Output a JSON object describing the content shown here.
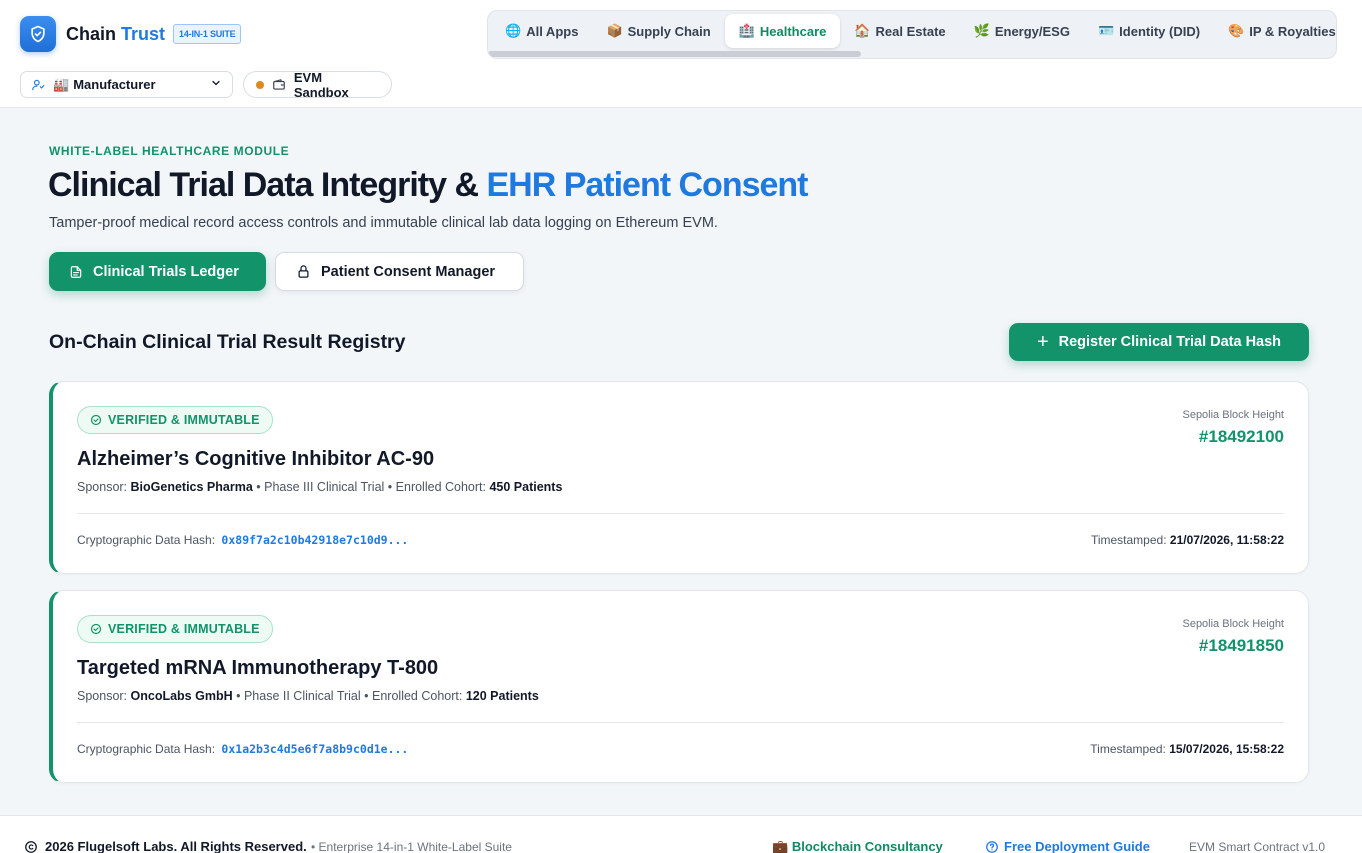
{
  "brand": {
    "name": "Chain",
    "accent": "Trust",
    "badge": "14-IN-1 SUITE"
  },
  "header": {
    "role": {
      "icon": "🏭",
      "label": "Manufacturer"
    },
    "network": {
      "label": "EVM Sandbox"
    },
    "tabs": [
      {
        "icon": "🌐",
        "label": "All Apps"
      },
      {
        "icon": "📦",
        "label": "Supply Chain"
      },
      {
        "icon": "🏥",
        "label": "Healthcare"
      },
      {
        "icon": "🏠",
        "label": "Real Estate"
      },
      {
        "icon": "🌿",
        "label": "Energy/ESG"
      },
      {
        "icon": "🪪",
        "label": "Identity (DID)"
      },
      {
        "icon": "🎨",
        "label": "IP & Royalties"
      }
    ],
    "active_tab": "Healthcare"
  },
  "hero": {
    "eyebrow": "WHITE-LABEL HEALTHCARE MODULE",
    "title_main": "Clinical Trial Data Integrity & ",
    "title_accent": "EHR Patient Consent",
    "subtitle": "Tamper-proof medical record access controls and immutable clinical lab data logging on Ethereum EVM.",
    "modules": {
      "primary": "Clinical Trials Ledger",
      "secondary": "Patient Consent Manager"
    }
  },
  "registry": {
    "title": "On-Chain Clinical Trial Result Registry",
    "register_label": "Register Clinical Trial Data Hash",
    "trials": [
      {
        "status": "VERIFIED & IMMUTABLE",
        "name": "Alzheimer’s Cognitive Inhibitor AC-90",
        "sponsor_label": "Sponsor:",
        "sponsor": "BioGenetics Pharma",
        "phase": "Phase III Clinical Trial",
        "cohort_label": "Enrolled Cohort:",
        "cohort": "450 Patients",
        "block_label": "Sepolia Block Height",
        "block": "#18492100",
        "hash_label": "Cryptographic Data Hash:",
        "hash": "0x89f7a2c10b42918e7c10d9...",
        "time_label": "Timestamped:",
        "time": "21/07/2026, 11:58:22"
      },
      {
        "status": "VERIFIED & IMMUTABLE",
        "name": "Targeted mRNA Immunotherapy T-800",
        "sponsor_label": "Sponsor:",
        "sponsor": "OncoLabs GmbH",
        "phase": "Phase II Clinical Trial",
        "cohort_label": "Enrolled Cohort:",
        "cohort": "120 Patients",
        "block_label": "Sepolia Block Height",
        "block": "#18491850",
        "hash_label": "Cryptographic Data Hash:",
        "hash": "0x1a2b3c4d5e6f7a8b9c0d1e...",
        "time_label": "Timestamped:",
        "time": "15/07/2026, 15:58:22"
      }
    ]
  },
  "footer": {
    "copyright": "2026 Flugelsoft Labs. All Rights Reserved.",
    "suite": "• Enterprise 14-in-1 White-Label Suite",
    "consultancy_icon": "💼",
    "consultancy": "Blockchain Consultancy",
    "guide": "Free Deployment Guide",
    "version": "EVM Smart Contract v1.0"
  },
  "colors": {
    "primary_green": "#13936a",
    "accent_blue": "#1f7ae0",
    "network_dot": "#e08a1e"
  }
}
